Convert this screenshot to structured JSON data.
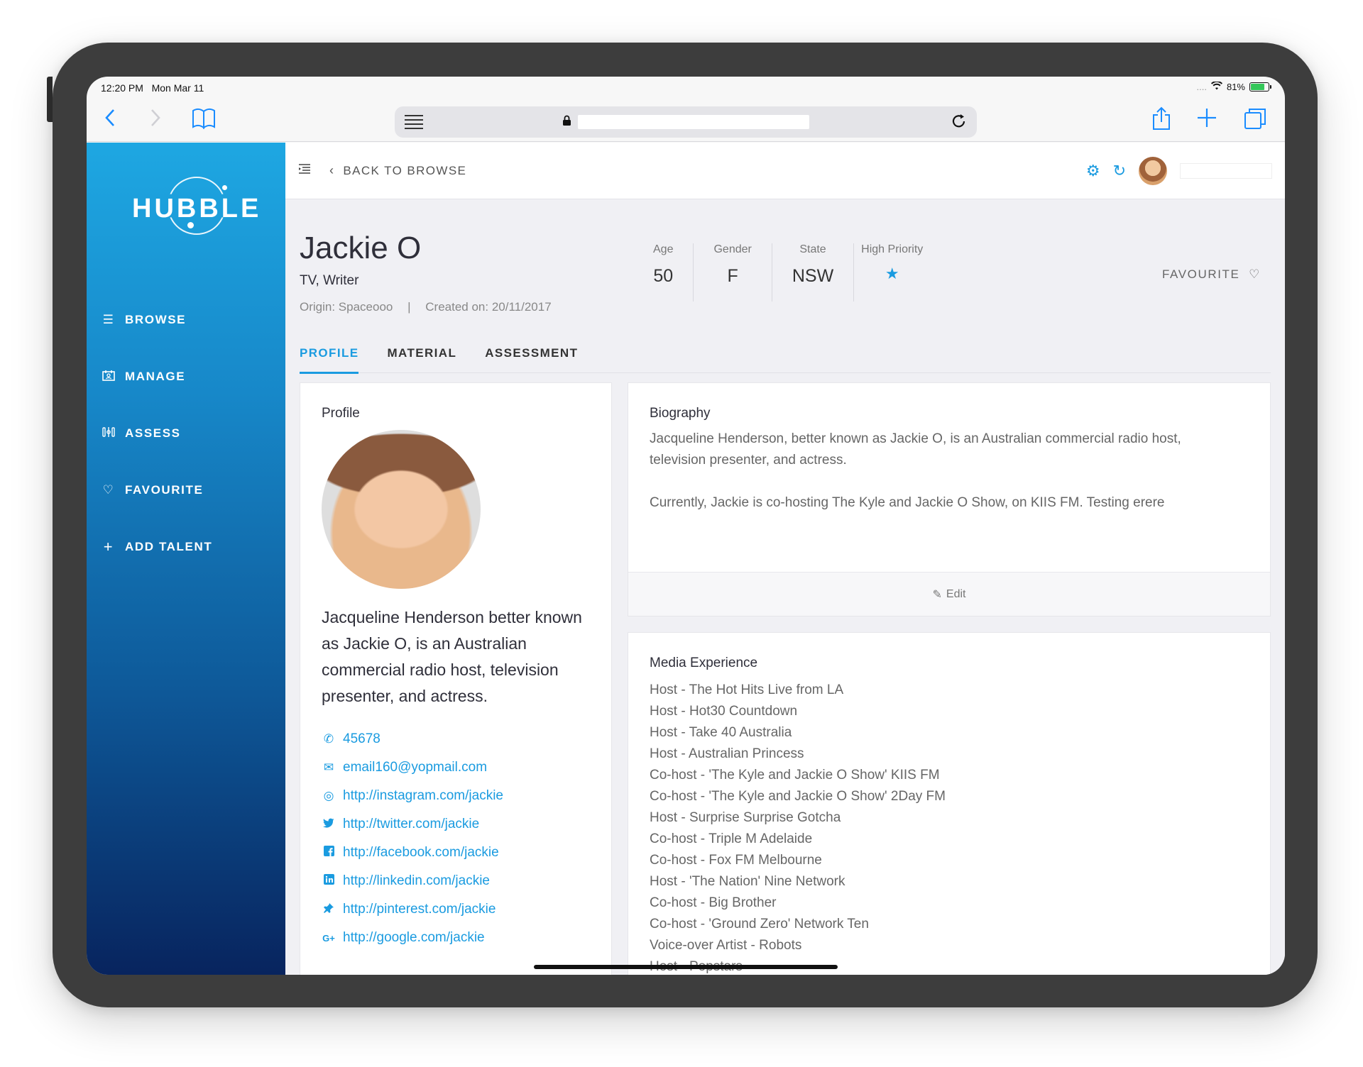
{
  "status_bar": {
    "time": "12:20 PM",
    "date": "Mon Mar 11",
    "signal": "....",
    "battery": "81%",
    "battery_level": 0.81
  },
  "browser": {
    "icons": {
      "back": "chevron-left-icon",
      "forward": "chevron-right-icon",
      "bookmarks": "book-icon",
      "reader": "reader-icon",
      "lock": "lock-icon",
      "reload": "reload-icon",
      "share": "share-icon",
      "new_tab": "plus-icon",
      "tabs": "tabs-icon"
    }
  },
  "sidebar": {
    "logo": "HUBBLE",
    "items": [
      {
        "label": "BROWSE",
        "icon": "list-icon"
      },
      {
        "label": "MANAGE",
        "icon": "calendar-user-icon"
      },
      {
        "label": "ASSESS",
        "icon": "sliders-icon"
      },
      {
        "label": "FAVOURITE",
        "icon": "heart-icon"
      },
      {
        "label": "ADD TALENT",
        "icon": "plus-icon"
      }
    ]
  },
  "topbar": {
    "back_label": "BACK TO BROWSE"
  },
  "talent": {
    "name": "Jackie O",
    "roles": "TV, Writer",
    "origin": "Origin: Spaceooo",
    "created": "Created on: 20/11/2017",
    "stats": [
      {
        "label": "Age",
        "value": "50"
      },
      {
        "label": "Gender",
        "value": "F"
      },
      {
        "label": "State",
        "value": "NSW"
      }
    ],
    "high_priority_label": "High Priority",
    "high_priority": true,
    "favourite_label": "FAVOURITE"
  },
  "tabs": [
    {
      "label": "PROFILE",
      "active": true
    },
    {
      "label": "MATERIAL",
      "active": false
    },
    {
      "label": "ASSESSMENT",
      "active": false
    }
  ],
  "profile_card": {
    "title": "Profile",
    "summary": "Jacqueline Henderson better known as Jackie O, is an Australian commercial radio host, television presenter, and actress.",
    "contacts": [
      {
        "type": "phone",
        "icon": "phone-icon",
        "glyph": "✆",
        "value": "45678"
      },
      {
        "type": "email",
        "icon": "email-icon",
        "glyph": "✉",
        "value": "email160@yopmail.com"
      },
      {
        "type": "instagram",
        "icon": "instagram-icon",
        "glyph": "◎",
        "value": "http://instagram.com/jackie"
      },
      {
        "type": "twitter",
        "icon": "twitter-icon",
        "glyph": "🐦",
        "value": "http://twitter.com/jackie"
      },
      {
        "type": "facebook",
        "icon": "facebook-icon",
        "glyph": "f",
        "value": "http://facebook.com/jackie"
      },
      {
        "type": "linkedin",
        "icon": "linkedin-icon",
        "glyph": "in",
        "value": "http://linkedin.com/jackie"
      },
      {
        "type": "pinterest",
        "icon": "pin-icon",
        "glyph": "📌",
        "value": "http://pinterest.com/jackie"
      },
      {
        "type": "google",
        "icon": "google-plus-icon",
        "glyph": "G+",
        "value": "http://google.com/jackie"
      }
    ]
  },
  "biography": {
    "title": "Biography",
    "paragraphs": [
      "Jacqueline Henderson, better known as Jackie O, is an Australian commercial radio host, television presenter, and actress.",
      "Currently, Jackie is co-hosting The Kyle and Jackie O Show, on KIIS FM. Testing erere"
    ],
    "edit_label": "Edit"
  },
  "media_experience": {
    "title": "Media Experience",
    "items": [
      "Host - The Hot Hits Live from LA",
      "Host - Hot30 Countdown",
      "Host - Take 40 Australia",
      "Host - Australian Princess",
      "Co-host - 'The Kyle and Jackie O Show' KIIS FM",
      "Co-host - 'The Kyle and Jackie O Show' 2Day FM",
      "Host - Surprise Surprise Gotcha",
      "Co-host - Triple M Adelaide",
      "Co-host - Fox FM Melbourne",
      "Host - 'The Nation' Nine Network",
      "Co-host - Big Brother",
      "Co-host - 'Ground Zero' Network Ten",
      "Voice-over Artist - Robots",
      "Host - Popstars"
    ]
  },
  "colors": {
    "accent": "#1a9be0",
    "sidebar_top": "#1ea7e2",
    "sidebar_bottom": "#08245e",
    "safari_blue": "#1a8cff"
  }
}
